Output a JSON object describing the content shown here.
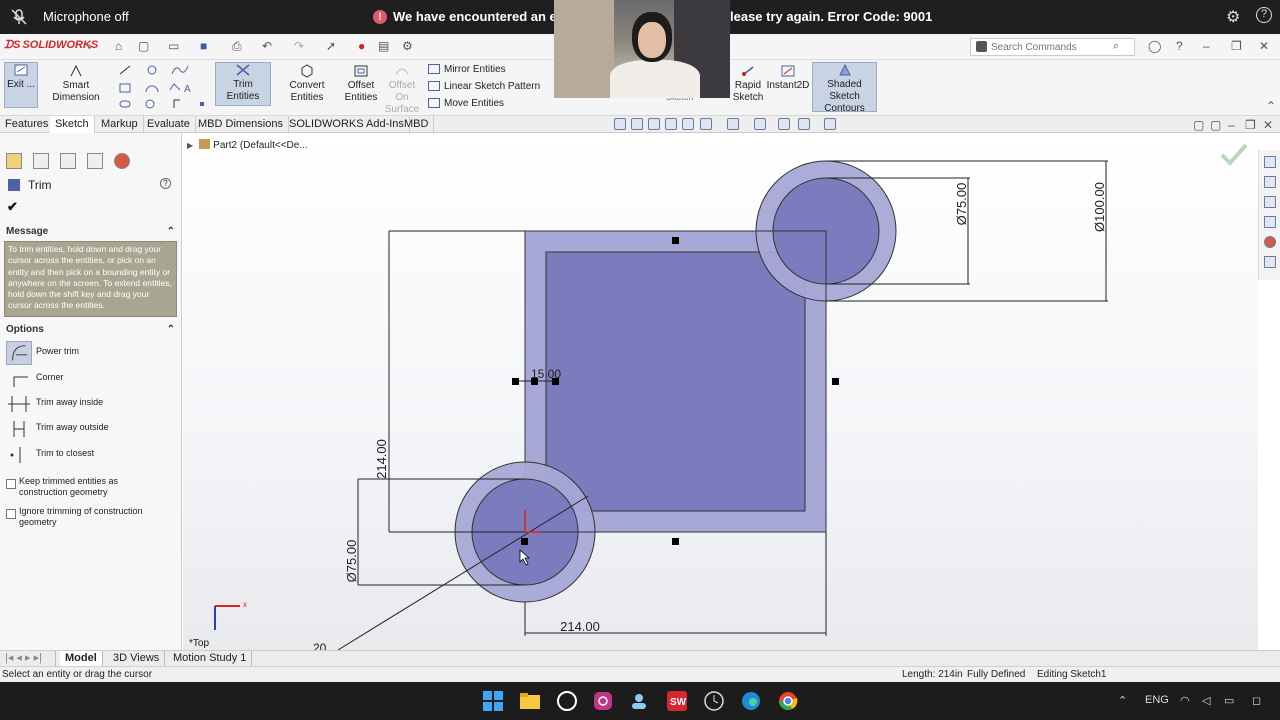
{
  "notification": {
    "mic_label": "Microphone off",
    "error_left": "We have encountered an error",
    "error_right": "lease try again. Error Code: 9001"
  },
  "app": {
    "logo_text": "SOLIDWORKS",
    "search_placeholder": "Search Commands"
  },
  "command_manager": {
    "exit_label": "Exit ...",
    "smart_dimension": "Smart Dimension",
    "trim_entities": "Trim Entities",
    "convert_entities": "Convert Entities",
    "offset_entities_1": "Offset",
    "offset_entities_2": "Entities",
    "offset_surface_1": "Offset On",
    "offset_surface_2": "Surface",
    "mirror_entities": "Mirror Entities",
    "linear_pattern": "Linear Sketch Pattern",
    "move_entities": "Move Entities",
    "rapid_sketch_1": "Rapid",
    "rapid_sketch_2": "Sketch",
    "instant2d": "Instant2D",
    "shaded_contours_1": "Shaded Sketch",
    "shaded_contours_2": "Contours",
    "sketch_partial": "Sketch"
  },
  "tabs": [
    "Features",
    "Sketch",
    "Markup",
    "Evaluate",
    "MBD Dimensions",
    "SOLIDWORKS Add-Ins",
    "MBD"
  ],
  "property_manager": {
    "title": "Trim",
    "message_header": "Message",
    "message_text": "To trim entities, hold down and drag your cursor across the entities, or pick on an entity and then pick on a bounding entity or anywhere on the screen. To extend entities, hold down the shift key and drag your cursor across the entities.",
    "options_header": "Options",
    "options": [
      "Power trim",
      "Corner",
      "Trim away inside",
      "Trim away outside",
      "Trim to closest"
    ],
    "check_keep": "Keep trimmed entities as construction geometry",
    "check_ignore": "Ignore trimming of construction geometry"
  },
  "graphics": {
    "tree_node": "Part2  (Default<<De...",
    "view_label": "*Top",
    "dim_dia_100": "Ø100.00",
    "dim_dia_75_top": "Ø75.00",
    "dim_15": "15.00",
    "dim_214_vert": "214.00",
    "dim_dia_75_bottom": "Ø75.00",
    "dim_214_horiz": "214.00",
    "dim_partial": "20"
  },
  "bottom_tabs": [
    "Model",
    "3D Views",
    "Motion Study 1"
  ],
  "status": {
    "left": "Select an entity or drag the cursor",
    "length": "Length: 214in",
    "defined": "Fully Defined",
    "editing": "Editing Sketch1"
  },
  "taskbar": {
    "lang": "ENG"
  },
  "colors": {
    "accent": "#4b62a6",
    "sketch_fill": "#7b7cbe",
    "sketch_light": "#a7a8d6",
    "error": "#e05a6a",
    "logo_red": "#d6262e"
  }
}
